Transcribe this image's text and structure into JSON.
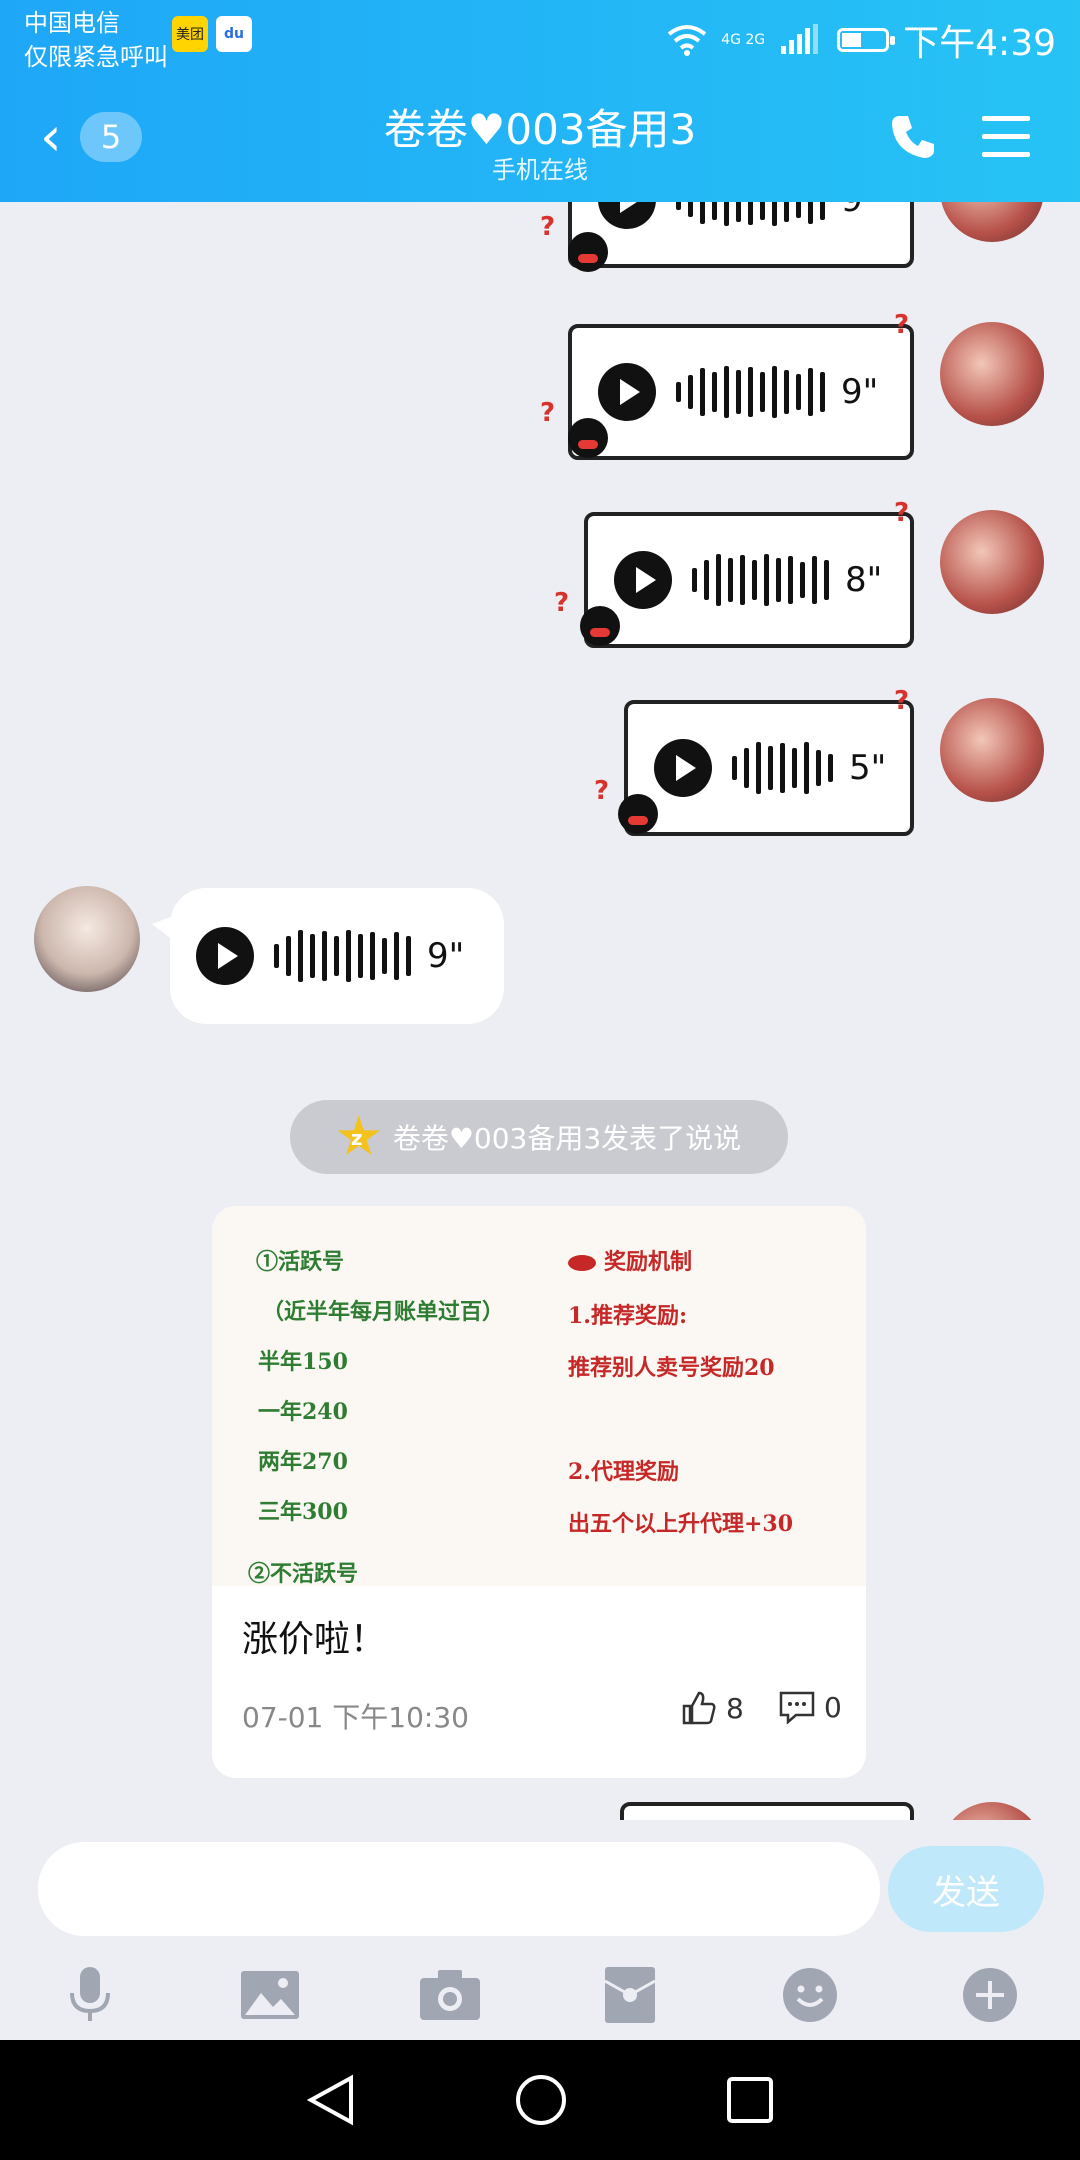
{
  "status": {
    "carrier": "中国电信",
    "emergency": "仅限紧急呼叫",
    "apps": [
      "美团",
      "du"
    ],
    "signal": "4G 2G",
    "time": "下午4:39"
  },
  "header": {
    "unread": "5",
    "title": "卷卷♥003备用3",
    "subtitle": "手机在线"
  },
  "voice_messages": [
    {
      "duration": "9\""
    },
    {
      "duration": "9\""
    },
    {
      "duration": "8\""
    },
    {
      "duration": "5\""
    },
    {
      "duration": "9\""
    }
  ],
  "system_notice": "卷卷♥003备用3发表了说说",
  "post": {
    "image_text": {
      "active": "①活跃号",
      "active_note": "（近半年每月账单过百）",
      "p1": "半年150",
      "p2": "一年240",
      "p3": "两年270",
      "p4": "三年300",
      "inactive": "②不活跃号",
      "reward": "奖励机制",
      "r1": "1.推荐奖励:",
      "r2": "推荐别人卖号奖励20",
      "r3": "2.代理奖励",
      "r4": "出五个以上升代理+30"
    },
    "text": "涨价啦！",
    "time": "07-01 下午10:30",
    "likes": "8",
    "comments": "0"
  },
  "input": {
    "send_label": "发送"
  }
}
